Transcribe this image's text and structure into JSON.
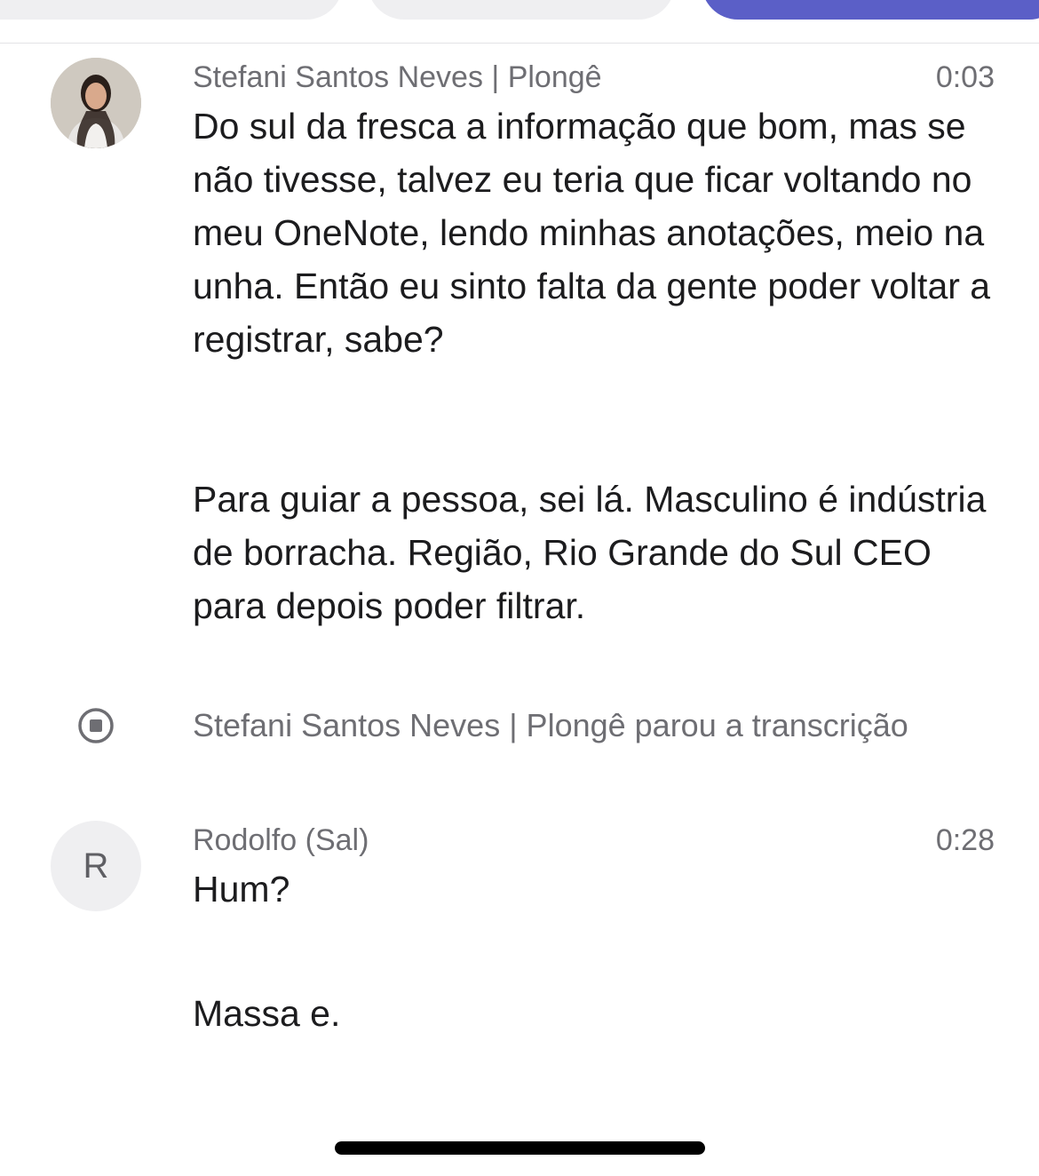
{
  "messages": [
    {
      "sender": "Stefani Santos Neves | Plongê",
      "time": "0:03",
      "avatar_type": "photo",
      "paragraphs": [
        "Do sul da fresca a informação que bom, mas se não tivesse, talvez eu teria que ficar voltando no meu OneNote, lendo minhas anotações, meio na unha. Então eu sinto falta da gente poder voltar a registrar, sabe?",
        "Para guiar a pessoa, sei lá. Masculino é indústria de borracha. Região, Rio Grande do Sul CEO para depois poder filtrar."
      ]
    },
    {
      "sender": "Rodolfo (Sal)",
      "time": "0:28",
      "avatar_initial": "R",
      "paragraphs": [
        "Hum?",
        "Massa e."
      ]
    }
  ],
  "event": {
    "icon": "stop-circle-icon",
    "text": "Stefani Santos Neves | Plongê parou a transcrição"
  },
  "colors": {
    "accent": "#5b5fc7",
    "secondary_text": "#6e6e73",
    "primary_text": "#1c1c1e"
  }
}
